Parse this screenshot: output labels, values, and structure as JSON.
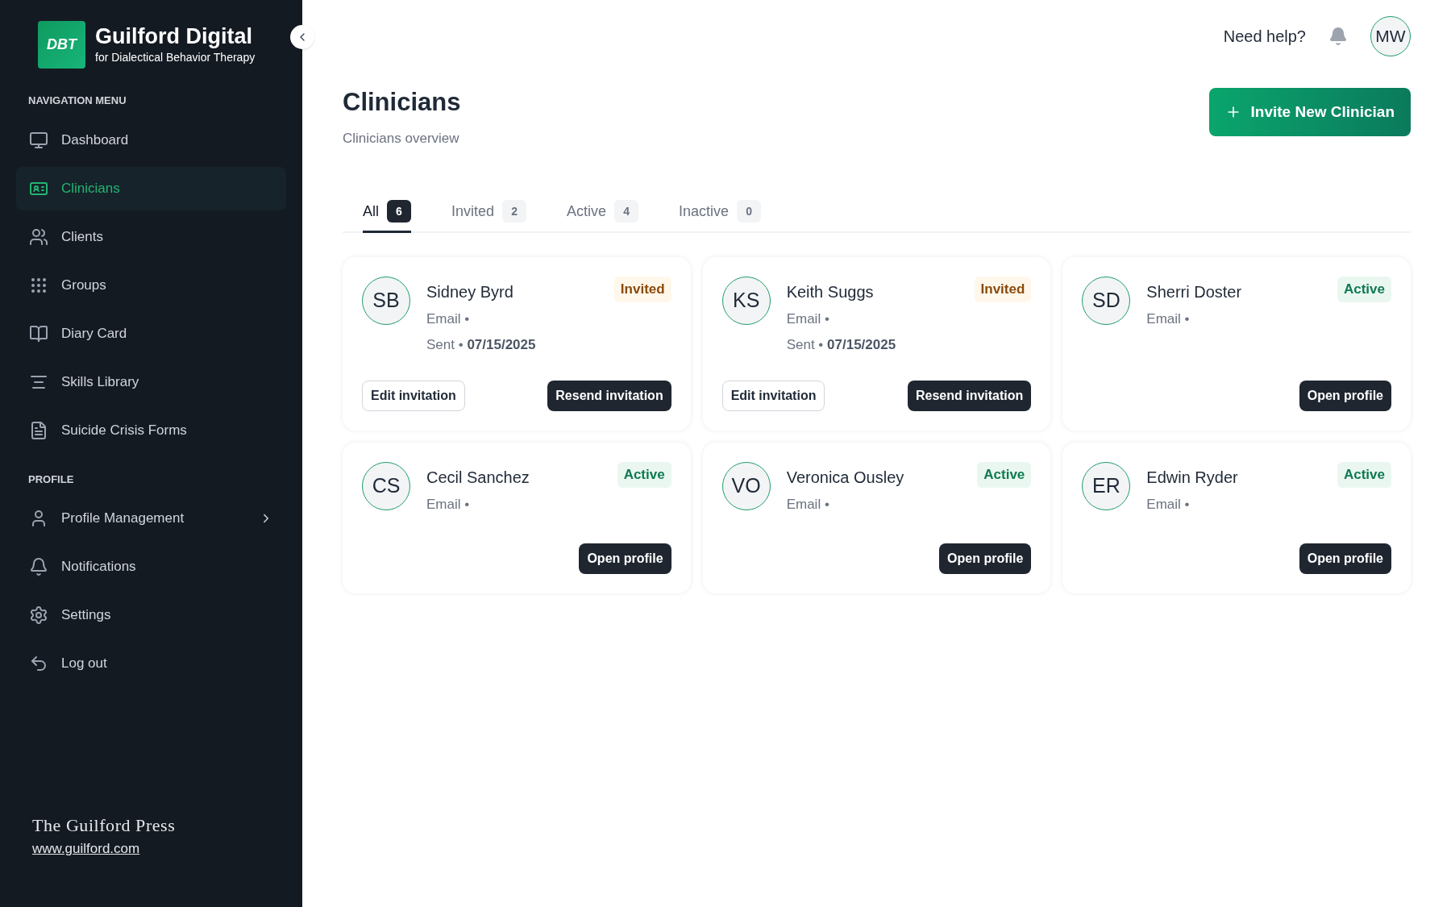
{
  "brand": {
    "logo_text": "DBT",
    "name": "Guilford Digital",
    "tagline": "for Dialectical Behavior Therapy"
  },
  "sidebar": {
    "sections": [
      {
        "heading": "NAVIGATION MENU",
        "items": [
          {
            "label": "Dashboard",
            "selected": false,
            "has_submenu": false
          },
          {
            "label": "Clinicians",
            "selected": true,
            "has_submenu": false
          },
          {
            "label": "Clients",
            "selected": false,
            "has_submenu": false
          },
          {
            "label": "Groups",
            "selected": false,
            "has_submenu": false
          },
          {
            "label": "Diary Card",
            "selected": false,
            "has_submenu": false
          },
          {
            "label": "Skills Library",
            "selected": false,
            "has_submenu": false
          },
          {
            "label": "Suicide Crisis Forms",
            "selected": false,
            "has_submenu": false
          }
        ]
      },
      {
        "heading": "PROFILE",
        "items": [
          {
            "label": "Profile Management",
            "selected": false,
            "has_submenu": true
          },
          {
            "label": "Notifications",
            "selected": false,
            "has_submenu": false
          },
          {
            "label": "Settings",
            "selected": false,
            "has_submenu": false
          },
          {
            "label": "Log out",
            "selected": false,
            "has_submenu": false
          }
        ]
      }
    ],
    "footer": {
      "publisher": "The Guilford Press",
      "link": "www.guilford.com"
    }
  },
  "header": {
    "help": "Need help?",
    "avatar": "MW"
  },
  "page": {
    "title": "Clinicians",
    "subtitle": "Clinicians overview",
    "action": "Invite New Clinician"
  },
  "tabs": [
    {
      "label": "All",
      "count": "6",
      "selected": true
    },
    {
      "label": "Invited",
      "count": "2",
      "selected": false
    },
    {
      "label": "Active",
      "count": "4",
      "selected": false
    },
    {
      "label": "Inactive",
      "count": "0",
      "selected": false
    }
  ],
  "cards": [
    {
      "kind": "invited",
      "initials": "SB",
      "name": "Sidney Byrd",
      "status": "Invited",
      "email": "Email •",
      "sent_label": "Sent •",
      "sent_date": "07/15/2025",
      "buttons": [
        "Edit invitation",
        "Resend invitation"
      ]
    },
    {
      "kind": "invited",
      "initials": "KS",
      "name": "Keith Suggs",
      "status": "Invited",
      "email": "Email •",
      "sent_label": "Sent •",
      "sent_date": "07/15/2025",
      "buttons": [
        "Edit invitation",
        "Resend invitation"
      ]
    },
    {
      "kind": "active",
      "initials": "SD",
      "name": "Sherri Doster",
      "status": "Active",
      "email": "Email •",
      "buttons": [
        "Open profile"
      ]
    },
    {
      "kind": "active",
      "initials": "CS",
      "name": "Cecil Sanchez",
      "status": "Active",
      "email": "Email •",
      "buttons": [
        "Open profile"
      ]
    },
    {
      "kind": "active",
      "initials": "VO",
      "name": "Veronica Ousley",
      "status": "Active",
      "email": "Email •",
      "buttons": [
        "Open profile"
      ]
    },
    {
      "kind": "active",
      "initials": "ER",
      "name": "Edwin Ryder",
      "status": "Active",
      "email": "Email •",
      "buttons": [
        "Open profile"
      ]
    }
  ]
}
